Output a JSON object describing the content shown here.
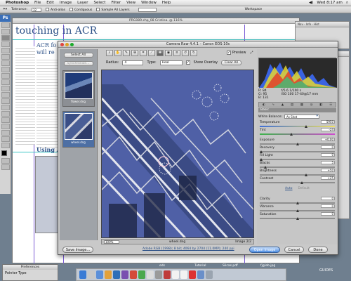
{
  "menubar": {
    "app": "Photoshop",
    "items": [
      "File",
      "Edit",
      "Image",
      "Layer",
      "Select",
      "Filter",
      "View",
      "Window",
      "Help"
    ],
    "clock": "Wed 8:17 am"
  },
  "options_bar": {
    "tolerance_label": "Tolerance:",
    "tolerance_value": "32",
    "anti_alias": "Anti-alias",
    "contiguous": "Contiguous",
    "sample_all": "Sample All Layers",
    "workspace": "Workspace"
  },
  "document": {
    "title": "PRG089.chp_08 Cristina. @ 116%",
    "headline": "touching in ACR",
    "subhead_1": "ACR fo",
    "subhead_2": "will re",
    "using": "Using A"
  },
  "camera_raw": {
    "title": "Camera Raw 4.4.1 – Canon EOS-10s",
    "preview_label": "Preview",
    "tools": [
      "zoom",
      "hand",
      "wb",
      "color-sampler",
      "crop",
      "straighten",
      "retouch",
      "red-eye",
      "prefs",
      "rotate-ccw",
      "rotate-cw"
    ],
    "radius_label": "Radius:",
    "radius_value": "4",
    "type_label": "Type:",
    "type_value": "Heal",
    "show_overlay": "Show Overlay",
    "clear_all": "Clear All",
    "select_all": "Select All",
    "synchronize": "Synchronize...",
    "thumb_1": "flower.dng",
    "thumb_2": "wheel.dng",
    "zoom_value": "100%",
    "image_name": "wheel.dng",
    "image_count": "Image 2/2",
    "rgb_r": "R:",
    "rgb_g": "G:",
    "rgb_b": "B:",
    "rgb_r_val": "84",
    "rgb_g_val": "95",
    "rgb_b_val": "131",
    "exif_1": "f/5.6   1/100 s",
    "exif_2": "ISO 100   17-40@17 mm",
    "basic_label": "Basic",
    "white_balance_label": "White Balance:",
    "white_balance_value": "As Shot",
    "auto": "Auto",
    "default": "Default",
    "sliders": [
      {
        "label": "Temperature",
        "value": "5950",
        "pos": 0.62
      },
      {
        "label": "Tint",
        "value": "-24",
        "pos": 0.42
      },
      {
        "label": "Exposure",
        "value": "+0.00",
        "pos": 0.5
      },
      {
        "label": "Recovery",
        "value": "0",
        "pos": 0.0
      },
      {
        "label": "Fill Light",
        "value": "0",
        "pos": 0.0
      },
      {
        "label": "Blacks",
        "value": "5",
        "pos": 0.06
      },
      {
        "label": "Brightness",
        "value": "+50",
        "pos": 0.62
      },
      {
        "label": "Contrast",
        "value": "+25",
        "pos": 0.56
      },
      {
        "label": "Clarity",
        "value": "0",
        "pos": 0.5
      },
      {
        "label": "Vibrance",
        "value": "0",
        "pos": 0.5
      },
      {
        "label": "Saturation",
        "value": "0",
        "pos": 0.5
      }
    ],
    "save_image": "Save Image...",
    "workflow_link": "Adobe RGB (1998); 8 bit; 4064 by 2704 (11.0MP); 240 ppi",
    "open_image": "Open Image",
    "cancel": "Cancel",
    "done": "Done"
  },
  "prefs_panel": {
    "title": "Preferences",
    "pointer_type": "Pointer Type"
  },
  "dock": {
    "label_1": "eds",
    "label_2": "Tutorial",
    "label_3": "Slicas.pdf",
    "label_4": "fjg/eb.jpg"
  },
  "desktop_label": "GUIDES",
  "colors": {
    "accent": "#2a4f86",
    "image_sky": "#4f60a6",
    "photoshop_blue": "#3a6fb8"
  }
}
